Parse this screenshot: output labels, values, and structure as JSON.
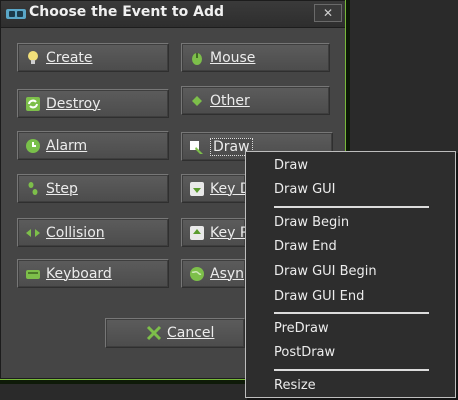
{
  "window": {
    "title": "Choose the Event to Add",
    "close_label": "✕"
  },
  "buttons": {
    "create": "Create",
    "mouse": "Mouse",
    "destroy": "Destroy",
    "other": "Other",
    "alarm": "Alarm",
    "draw": "Draw",
    "step": "Step",
    "key_down": "Key D",
    "collision": "Collision",
    "key_press": "Key P",
    "keyboard": "Keyboard",
    "async": "Asyn",
    "cancel": "Cancel"
  },
  "context_menu": {
    "items": [
      "Draw",
      "Draw GUI",
      "Draw Begin",
      "Draw End",
      "Draw GUI Begin",
      "Draw GUI End",
      "PreDraw",
      "PostDraw",
      "Resize"
    ]
  },
  "colors": {
    "accent_green": "#78b93a",
    "window_bg": "#454545",
    "menu_bg": "#2d2d2d"
  }
}
